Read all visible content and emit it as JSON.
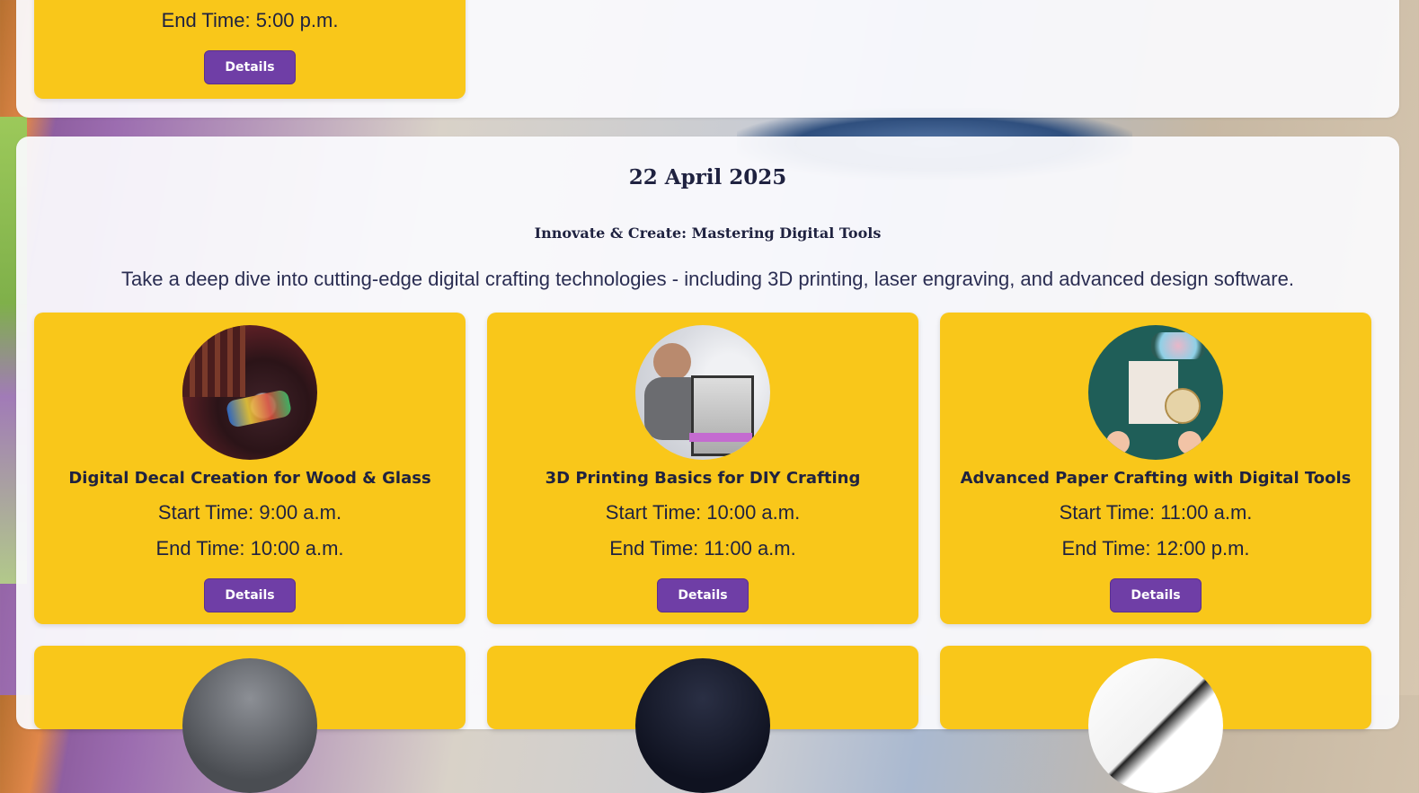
{
  "top_section": {
    "card": {
      "end_time": "End Time: 5:00 p.m.",
      "button_label": "Details"
    }
  },
  "day": {
    "date": "22 April 2025",
    "subtitle": "Innovate & Create: Mastering Digital Tools",
    "description": "Take a deep dive into cutting-edge digital crafting technologies - including 3D printing, laser engraving, and advanced design software.",
    "workshops": [
      {
        "title": "Digital Decal Creation for Wood & Glass",
        "start_time": "Start Time: 9:00 a.m.",
        "end_time": "End Time: 10:00 a.m.",
        "button_label": "Details",
        "image_icon": "workshop-photo-decals"
      },
      {
        "title": "3D Printing Basics for DIY Crafting",
        "start_time": "Start Time: 10:00 a.m.",
        "end_time": "End Time: 11:00 a.m.",
        "button_label": "Details",
        "image_icon": "workshop-photo-3d-printer"
      },
      {
        "title": "Advanced Paper Crafting with Digital Tools",
        "start_time": "Start Time: 11:00 a.m.",
        "end_time": "End Time: 12:00 p.m.",
        "button_label": "Details",
        "image_icon": "workshop-photo-paper-crafting"
      }
    ]
  },
  "colors": {
    "card_background": "#f9c71a",
    "button_background": "#6f3ea6",
    "text_primary": "#1f2240",
    "panel_background": "#fafafd"
  }
}
